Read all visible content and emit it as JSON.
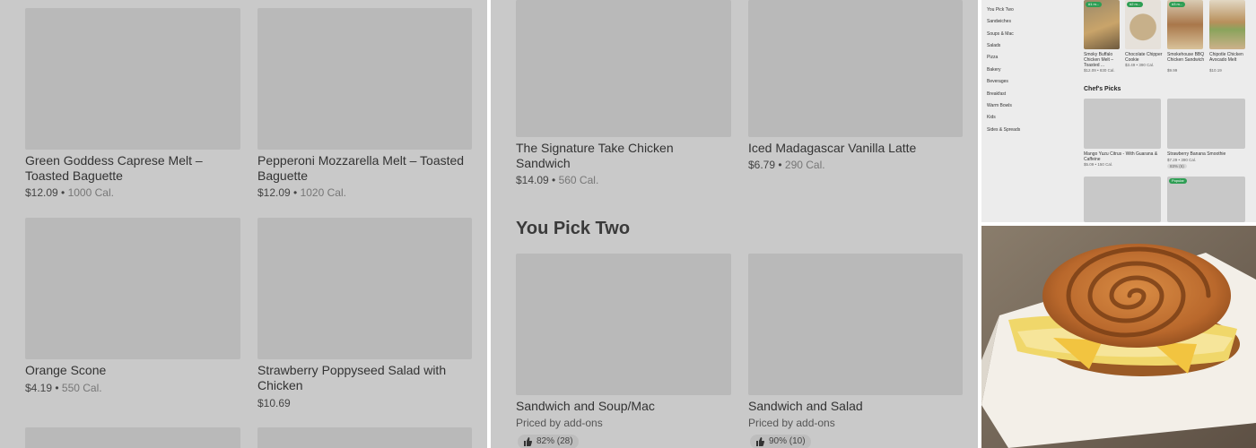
{
  "panel1": {
    "items": [
      {
        "title": "Green Goddess Caprese Melt – Toasted Baguette",
        "price": "$12.09",
        "cal": "1000 Cal."
      },
      {
        "title": "Pepperoni Mozzarella Melt – Toasted Baguette",
        "price": "$12.09",
        "cal": "1020 Cal."
      },
      {
        "title": "Orange Scone",
        "price": "$4.19",
        "cal": "550 Cal."
      },
      {
        "title": "Strawberry Poppyseed Salad with Chicken",
        "price": "$10.69",
        "cal": ""
      }
    ]
  },
  "panel2": {
    "items": [
      {
        "title": "The Signature Take Chicken Sandwich",
        "price": "$14.09",
        "cal": "560 Cal."
      },
      {
        "title": "Iced Madagascar Vanilla Latte",
        "price": "$6.79",
        "cal": "290 Cal."
      }
    ],
    "section_title": "You Pick Two",
    "pick_two": [
      {
        "title": "Sandwich and Soup/Mac",
        "sub": "Priced by add-ons",
        "rating": "82% (28)"
      },
      {
        "title": "Sandwich and Salad",
        "sub": "Priced by add-ons",
        "rating": "90% (10)"
      }
    ]
  },
  "panel3": {
    "nav": [
      "You Pick Two",
      "Sandwiches",
      "Soups & Mac",
      "Salads",
      "Pizza",
      "Bakery",
      "Beverages",
      "Breakfast",
      "Warm Bowls",
      "Kids",
      "Sides & Spreads"
    ],
    "top_items": [
      {
        "name": "Smoky Buffalo Chicken Melt – Toasted ...",
        "price": "$12.09",
        "cal": "830 Cal.",
        "badge": "#1 m..."
      },
      {
        "name": "Chocolate Chipper Cookie",
        "price": "$3.49",
        "cal": "390 Cal.",
        "badge": "#2 m..."
      },
      {
        "name": "Smokehouse BBQ Chicken Sandwich",
        "price": "$9.99",
        "cal": "",
        "badge": "#3 m..."
      },
      {
        "name": "Chipotle Chicken Avocado Melt",
        "price": "$10.19",
        "cal": "",
        "badge": ""
      }
    ],
    "section_title": "Chef's Picks",
    "chef_items": [
      {
        "name": "Mango Yuzu Citrus - With Guarana & Caffeine",
        "price": "$5.09",
        "cal": "150 Cal."
      },
      {
        "name": "Strawberry Banana Smoothie",
        "price": "$7.29",
        "cal": "390 Cal.",
        "rating": "83% (6)"
      }
    ],
    "badge_popular": "Popular"
  },
  "colors": {
    "overlay_gray": "#c9c9c9",
    "badge_green": "#2e9e54"
  }
}
